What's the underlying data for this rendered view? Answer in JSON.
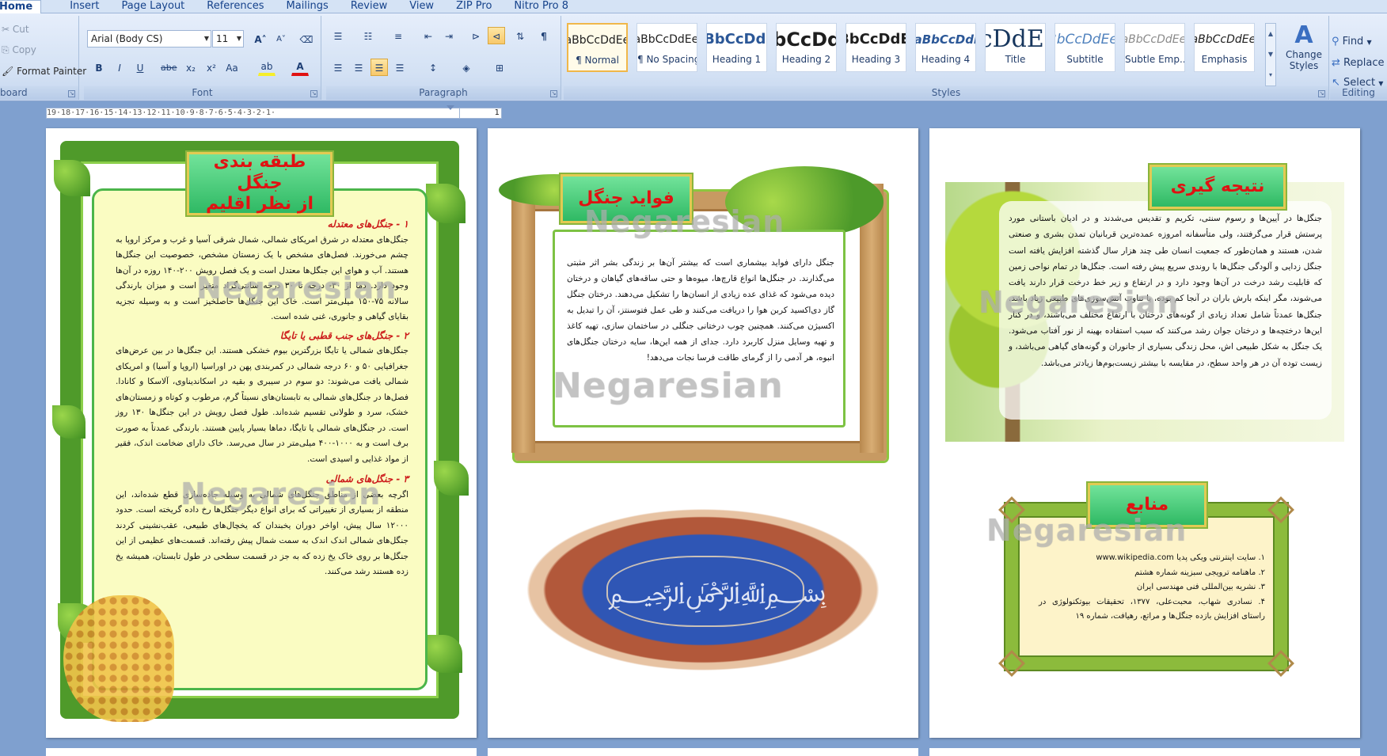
{
  "tabs": [
    "Home",
    "Insert",
    "Page Layout",
    "References",
    "Mailings",
    "Review",
    "View",
    "ZIP Pro",
    "Nitro Pro 8"
  ],
  "active_tab": "Home",
  "clipboard": {
    "cut": "Cut",
    "copy": "Copy",
    "format_painter": "Format Painter",
    "label": "board"
  },
  "font": {
    "family": "Arial (Body CS)",
    "size": "11",
    "grow": "A",
    "shrink": "A",
    "bold": "B",
    "italic": "I",
    "underline": "U",
    "strike": "abe",
    "subscript": "x₂",
    "superscript": "x²",
    "change_case": "Aa",
    "highlight": "ab",
    "font_color": "A",
    "label": "Font"
  },
  "paragraph": {
    "label": "Paragraph",
    "pilcrow": "¶"
  },
  "styles": {
    "label": "Styles",
    "items": [
      {
        "sample": "AaBbCcDdEe",
        "name": "¶ Normal"
      },
      {
        "sample": "AaBbCcDdEe",
        "name": "¶ No Spacing"
      },
      {
        "sample": "AaBbCcDdEe",
        "name": "Heading 1"
      },
      {
        "sample": "AaBbCcDdEe",
        "name": "Heading 2"
      },
      {
        "sample": "AaBbCcDdEe",
        "name": "Heading 3"
      },
      {
        "sample": "AaBbCcDdEe",
        "name": "Heading 4"
      },
      {
        "sample": "AaBbCcDdEe",
        "name": "Title"
      },
      {
        "sample": "AaBbCcDdEe",
        "name": "Subtitle"
      },
      {
        "sample": "AaBbCcDdEe",
        "name": "Subtle Emp..."
      },
      {
        "sample": "AaBbCcDdEe",
        "name": "Emphasis"
      }
    ],
    "change_styles": "Change Styles"
  },
  "editing": {
    "find": "Find",
    "replace": "Replace",
    "select": "Select",
    "label": "Editing"
  },
  "ruler": "19·18·17·16·15·14·13·12·11·10·9·8·7·6·5·4·3·2·1·",
  "ruler_right": "1",
  "watermark": "Negaresian",
  "page1": {
    "title_line1": "طبقه بندی جنگل",
    "title_line2": "از نظر اقلیم",
    "h1": "۱ - جنگل‌های معتدله",
    "p1": "جنگل‌های معتدله در شرق امریکای شمالی، شمال شرقی آسیا و غرب و مرکز اروپا به چشم می‌خورند. فصل‌های مشخص با یک زمستان مشخص، خصوصیت این جنگل‌ها هستند. آب و هوای این جنگل‌ها معتدل است و یک فصل رویش ۲۰۰-۱۴۰ روزه در آن‌ها وجود دارد. دما از ۳۰- درجه تا ۳۰ درجه سانتی‌گراد متغیر است و میزان بارندگی سالانه ۷۵-۱۵۰ میلی‌متر است. خاک این جنگل‌ها حاصلخیز است و به وسیله تجزیه بقایای گیاهی و جانوری، غنی شده است.",
    "h2": "۲ - جنگل‌های جنب قطبی یا تایگا",
    "p2": "جنگل‌های شمالی یا تایگا بزرگترین بیوم خشکی هستند. این جنگل‌ها در بین عرض‌های جغرافیایی ۵۰ و ۶۰ درجه شمالی در کمربندی پهن در اوراسیا (اروپا و آسیا) و امریکای شمالی یافت می‌شوند: دو سوم در سیبری و بقیه در اسکاندیناوی، آلاسکا و کانادا. فصل‌ها در جنگل‌های شمالی به تابستان‌های نسبتاً گرم، مرطوب و کوتاه و زمستان‌های خشک، سرد و طولانی تقسیم شده‌اند. طول فصل رویش در این جنگل‌ها ۱۳۰ روز است. در جنگل‌های شمالی یا تایگا، دماها بسیار پایین هستند. بارندگی عمدتاً به صورت برف است و به ۱۰۰۰-۴۰۰ میلی‌متر در سال می‌رسد. خاک دارای ضخامت اندک، فقیر از مواد غذایی و اسیدی است.",
    "h3": "۳ - جنگل‌های شمالی",
    "p3": "اگرچه بعضی از مناطق جنگل‌های شمالی به وسیله جاده‌سازی قطع شده‌اند، این منطقه از بسیاری از تغییراتی که برای انواع دیگر جنگل‌ها رخ داده گریخته است. حدود ۱۲۰۰۰ سال پیش، اواخر دوران یخبندان که یخچال‌های طبیعی، عقب‌نشینی کردند جنگل‌های شمالی اندک اندک به سمت شمال پیش رفته‌اند. قسمت‌های عظیمی از این جنگل‌ها بر روی خاک یخ زده که به جز در قسمت سطحی در طول تابستان، همیشه یخ زده هستند رشد می‌کنند."
  },
  "page2": {
    "title": "فواید جنگل",
    "p1": "جنگل دارای فواید بیشماری است که بیشتر آن‌ها بر زندگی بشر اثر مثبتی می‌گذارند. در جنگل‌ها انواع قارچ‌ها، میوه‌ها و حتی ساقه‌های گیاهان و درختان دیده می‌شود که غذای عده زیادی از انسان‌ها را تشکیل می‌دهند. درختان جنگل گاز دی‌اکسید کربن هوا را دریافت می‌کنند و طی عمل فتوسنتز، آن را تبدیل به اکسیژن می‌کنند. همچنین چوب درختانی جنگلی در ساختمان سازی، تهیه کاغذ و تهیه وسایل منزل کاربرد دارد. جدای از همه این‌ها، سایه درختان جنگل‌های انبوه، هر آدمی را از گرمای طاقت فرسا نجات می‌دهد!"
  },
  "page3": {
    "title": "نتیجه گیری",
    "p1": "جنگل‌ها در آیین‌ها و رسوم سنتی، تکریم و تقدیس می‌شدند و در ادیان باستانی مورد پرستش قرار می‌گرفتند، ولی متأسفانه امروزه عمده‌ترین قربانیان تمدن بشری و صنعتی شدن، هستند و همان‌طور که جمعیت انسان طی چند هزار سال گذشته افزایش یافته است جنگل زدایی و آلودگی جنگل‌ها با روندی سریع پیش رفته است. جنگل‌ها در تمام نواحی زمین که قابلیت رشد درخت در آن‌ها وجود دارد و در ارتفاع و زیر خط درخت قرار دارند یافت می‌شوند، مگر اینکه بارش باران در آنجا کم بوده، یا تناوب آتش‌سوزی‌های طبیعی زیاد باشد. جنگل‌ها عمدتاً شامل تعداد زیادی از گونه‌های درختان با ارتفاع مختلف می‌باشند، و در کنار این‌ها درختچه‌ها و درختان جوان رشد می‌کنند که سبب استفاده بهینه از نور آفتاب می‌شود. یک جنگل به شکل طبیعی اش، محل زندگی بسیاری از جانوران و گونه‌های گیاهی می‌باشد، و زیست توده آن در هر واحد سطح، در مقایسه با بیشتر زیست‌بوم‌ها زیادتر می‌باشد.",
    "refs_title": "منابع",
    "refs": [
      "۱. سایت اینترنتی ویکی پدیا www.wikipedia.com",
      "۲. ماهنامه ترویجی سبزینه شماره هشتم",
      "۳. نشریه بین‌المللی فنی مهندسی ایران",
      "۴. نسادری شهاب، محبت‌علی، ۱۳۷۷، تحقیقات بیوتکنولوژی در راستای افزایش بازده جنگل‌ها و مراتع، رهیافت، شماره ۱۹"
    ]
  },
  "colors": {
    "ribbon": "#d3e1f4",
    "title_text": "#e01212",
    "plaque": "#2fb964",
    "desktop": "#7fa0cf"
  }
}
